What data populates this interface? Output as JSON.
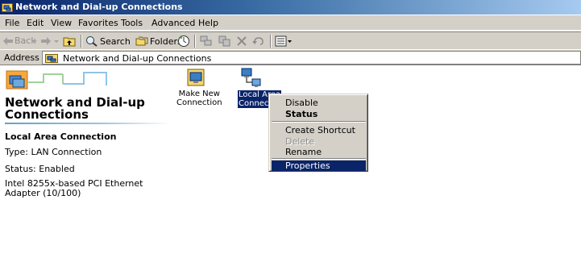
{
  "window": {
    "title": "Network and Dial-up Connections"
  },
  "menu": {
    "items": [
      "File",
      "Edit",
      "View",
      "Favorites",
      "Tools",
      "Advanced",
      "Help"
    ]
  },
  "toolbar": {
    "back_label": "Back",
    "search_label": "Search",
    "folders_label": "Folders",
    "icons": [
      "back-arrow-icon",
      "forward-arrow-icon",
      "up-folder-icon",
      "search-icon",
      "folders-icon",
      "history-icon",
      "move-to-icon",
      "copy-to-icon",
      "delete-icon",
      "undo-icon",
      "views-icon"
    ]
  },
  "address": {
    "label": "Address",
    "value": "Network and Dial-up Connections"
  },
  "left_pane": {
    "heading_line1": "Network and Dial-up",
    "heading_line2": "Connections",
    "selected_name": "Local Area Connection",
    "type": "Type: LAN Connection",
    "status": "Status: Enabled",
    "adapter_line1": "Intel 8255x-based PCI Ethernet",
    "adapter_line2": "Adapter (10/100)"
  },
  "icons": [
    {
      "line1": "Make New",
      "line2": "Connection"
    },
    {
      "line1": "Local Area",
      "line2": "Connect"
    }
  ],
  "context_menu": {
    "items": [
      {
        "label": "Disable",
        "bold": false,
        "disabled": false,
        "highlighted": false
      },
      {
        "label": "Status",
        "bold": true,
        "disabled": false,
        "highlighted": false
      },
      {
        "label": "Create Shortcut",
        "bold": false,
        "disabled": false,
        "highlighted": false
      },
      {
        "label": "Delete",
        "bold": false,
        "disabled": true,
        "highlighted": false
      },
      {
        "label": "Rename",
        "bold": false,
        "disabled": false,
        "highlighted": false
      },
      {
        "label": "Properties",
        "bold": false,
        "disabled": false,
        "highlighted": true
      }
    ]
  },
  "colors": {
    "title_bar": "#0a246a",
    "chrome": "#d4d0c8",
    "selection": "#0a246a"
  }
}
